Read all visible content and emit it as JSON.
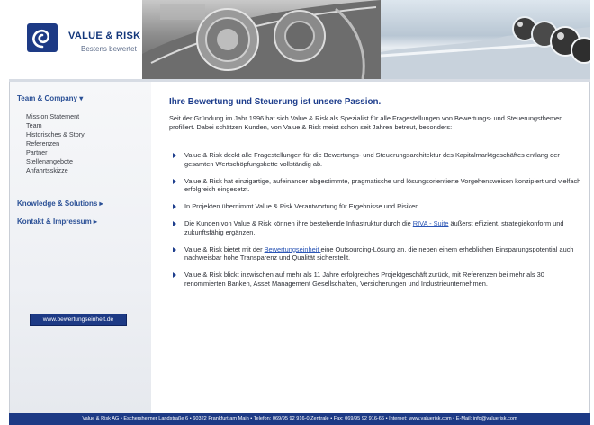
{
  "brand": {
    "name": "VALUE & RISK",
    "tagline": "Bestens bewertet",
    "color": "#13377b"
  },
  "banner": {
    "left_image": "car-headlights-photo",
    "right_image": "chrome-spheres-photo"
  },
  "sidebar": {
    "sections": [
      {
        "label": "Team & Company ▾",
        "icon": "chevron-down-icon"
      },
      {
        "label": "Knowledge & Solutions ▸",
        "icon": "chevron-right-icon"
      },
      {
        "label": "Kontakt & Impressum ▸",
        "icon": "chevron-right-icon"
      }
    ],
    "team_items": [
      "Mission Statement",
      "Team",
      "Historisches & Story",
      "Referenzen",
      "Partner",
      "Stellenangebote",
      "Anfahrtsskizze"
    ],
    "link_button": "www.bewertungseinheit.de"
  },
  "main": {
    "title": "Ihre Bewertung und Steuerung ist unsere Passion.",
    "intro": "Seit der Gründung im Jahr 1996 hat sich Value & Risk als Spezialist für alle Fragestellungen von Bewertungs- und Steuerungsthemen profiliert. Dabei schätzen Kunden, von Value & Risk meist schon seit Jahren betreut, besonders:",
    "bullets": [
      {
        "text": "Value & Risk deckt alle Fragestellungen für die Bewertungs- und Steuerungsarchitektur des Kapitalmarktgeschäftes entlang der gesamten Wertschöpfungskette vollständig ab."
      },
      {
        "text": "Value & Risk hat einzigartige, aufeinander abgestimmte, pragmatische und lösungsorientierte Vorgehensweisen konzipiert und vielfach erfolgreich eingesetzt."
      },
      {
        "text": "In Projekten übernimmt Value & Risk Verantwortung für Ergebnisse und Risiken."
      },
      {
        "before": "Die Kunden von Value & Risk können ihre bestehende Infrastruktur durch die ",
        "link": "RIVA - Suite",
        "after": " äußerst effizient, strategiekonform und zukunftsfähig ergänzen."
      },
      {
        "before": "Value & Risk bietet mit der ",
        "link": "Bewertungseinheit ",
        "after": "eine Outsourcing-Lösung an, die neben einem erheblichen Einsparungspotential auch nachweisbar hohe Transparenz und Qualität sicherstellt."
      },
      {
        "text": "Value & Risk blickt inzwischen auf mehr als 11 Jahre erfolgreiches Projektgeschäft zurück, mit Referenzen bei mehr als 30 renommierten Banken, Asset Management Gesellschaften, Versicherungen und Industrieunternehmen."
      }
    ]
  },
  "footer": {
    "text": "Value & Risk AG • Eschersheimer Landstraße 6 • 60322 Frankfurt am Main • Telefon: 069/95 92 916-0 Zentrale • Fax: 069/95 92 916-66 • Internet: www.valuerisk.com • E-Mail: info@valuerisk.com"
  },
  "colors": {
    "accent": "#1d3a85",
    "title": "#1d3d8c",
    "link": "#2a55b5"
  }
}
